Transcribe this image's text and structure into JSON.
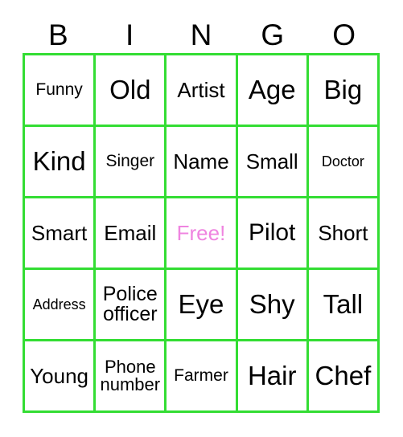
{
  "card": {
    "title_letters": [
      "B",
      "I",
      "N",
      "G",
      "O"
    ],
    "grid_color": "#33dd33",
    "free_color": "#ef84e0",
    "text_color": "#000000",
    "rows": [
      [
        {
          "label": "Funny",
          "size": "sm"
        },
        {
          "label": "Old",
          "size": "xl"
        },
        {
          "label": "Artist",
          "size": "md"
        },
        {
          "label": "Age",
          "size": "xl"
        },
        {
          "label": "Big",
          "size": "xl"
        }
      ],
      [
        {
          "label": "Kind",
          "size": "xl"
        },
        {
          "label": "Singer",
          "size": "sm"
        },
        {
          "label": "Name",
          "size": "md"
        },
        {
          "label": "Small",
          "size": "md"
        },
        {
          "label": "Doctor",
          "size": "xs"
        }
      ],
      [
        {
          "label": "Smart",
          "size": "md"
        },
        {
          "label": "Email",
          "size": "md"
        },
        {
          "label": "Free!",
          "size": "md",
          "free": true
        },
        {
          "label": "Pilot",
          "size": "lg"
        },
        {
          "label": "Short",
          "size": "md"
        }
      ],
      [
        {
          "label": "Address",
          "size": "xs"
        },
        {
          "label": "Police\nofficer",
          "size": "two"
        },
        {
          "label": "Eye",
          "size": "xl"
        },
        {
          "label": "Shy",
          "size": "xl"
        },
        {
          "label": "Tall",
          "size": "xl"
        }
      ],
      [
        {
          "label": "Young",
          "size": "md"
        },
        {
          "label": "Phone\nnumber",
          "size": "two-sm"
        },
        {
          "label": "Farmer",
          "size": "sm"
        },
        {
          "label": "Hair",
          "size": "xl"
        },
        {
          "label": "Chef",
          "size": "xl"
        }
      ]
    ]
  }
}
